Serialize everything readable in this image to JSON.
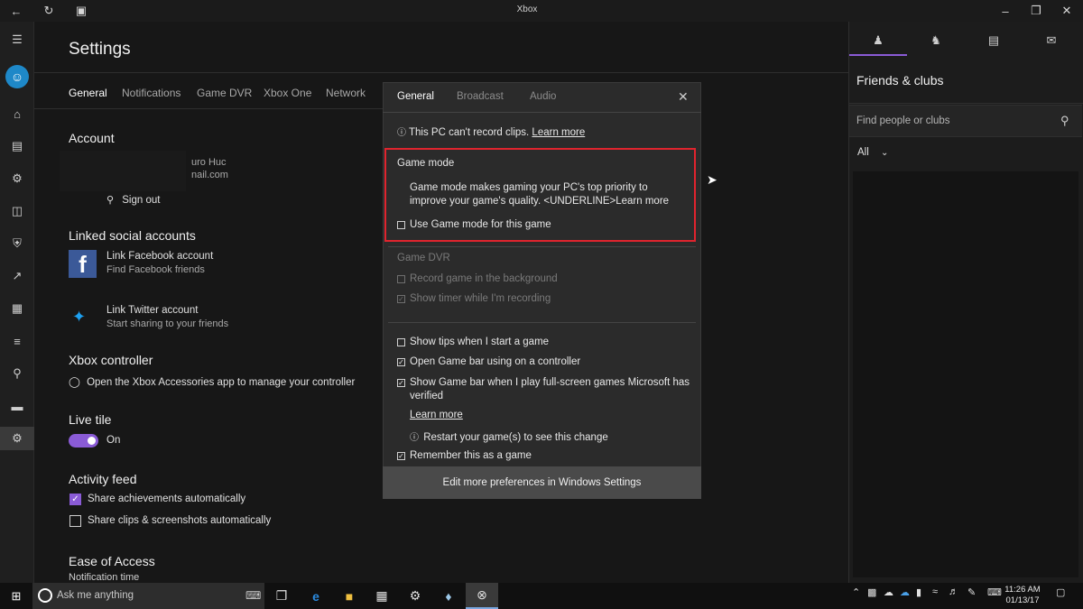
{
  "window": {
    "title": "Xbox"
  },
  "settings": {
    "title": "Settings",
    "tabs": [
      "General",
      "Notifications",
      "Game DVR",
      "Xbox One",
      "Network"
    ],
    "account": {
      "heading": "Account",
      "name_partial": "uro Huc",
      "email_partial": "nail.com",
      "sign_out": "Sign out"
    },
    "linked": {
      "heading": "Linked social accounts",
      "facebook": {
        "title": "Link Facebook account",
        "subtitle": "Find Facebook friends"
      },
      "twitter": {
        "title": "Link Twitter account",
        "subtitle": "Start sharing to your friends"
      }
    },
    "controller": {
      "heading": "Xbox controller",
      "text": "Open the Xbox Accessories app to manage your controller"
    },
    "live_tile": {
      "heading": "Live tile",
      "state": "On"
    },
    "activity": {
      "heading": "Activity feed",
      "share_achievements": "Share achievements automatically",
      "share_clips": "Share clips & screenshots automatically"
    },
    "ease": {
      "heading": "Ease of Access",
      "notification_time": "Notification time"
    }
  },
  "popup": {
    "tabs": [
      "General",
      "Broadcast",
      "Audio"
    ],
    "close_icon": "close-icon",
    "info_text": "This PC can't record clips.",
    "info_link": "Learn more",
    "game_mode": {
      "heading": "Game mode",
      "line1": "Game mode makes gaming your PC's top priority to",
      "line2": "improve your game's quality. <UNDERLINE>Learn more",
      "checkbox": "Use Game mode for this game"
    },
    "dvr": {
      "heading": "Game DVR",
      "record_bg": "Record game in the background",
      "show_timer": "Show timer while I'm recording"
    },
    "options": {
      "show_tips": "Show tips when I start a game",
      "open_bar": "Open Game bar using  on a controller",
      "show_bar_line1": "Show Game bar when I play full-screen games Microsoft has",
      "show_bar_line2": "verified",
      "learn_more": "Learn more",
      "restart": "Restart your game(s) to see this change",
      "remember": "Remember this as a game"
    },
    "edit_button": "Edit more preferences in Windows Settings"
  },
  "right_panel": {
    "title": "Friends & clubs",
    "search_placeholder": "Find people or clubs",
    "filter": "All"
  },
  "taskbar": {
    "search_placeholder": "Ask me anything",
    "time": "11:26 AM",
    "date": "01/13/17"
  },
  "colors": {
    "accent": "#8a5bd6",
    "highlight": "#e0242e",
    "facebook": "#3b5998",
    "twitter": "#1da1f2"
  }
}
